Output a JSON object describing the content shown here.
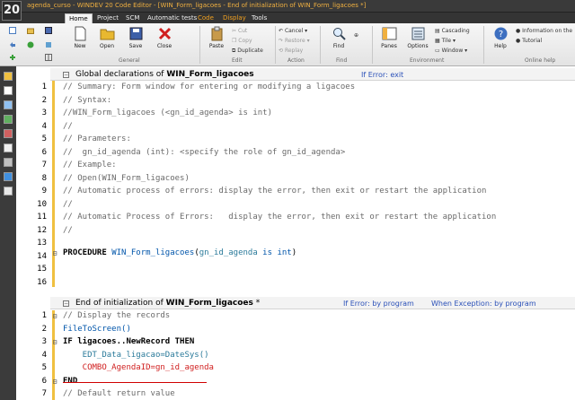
{
  "window": {
    "logo": "20",
    "title": "agenda_curso - WINDEV 20  Code Editor - [WIN_Form_ligacoes - End of initialization of WIN_Form_ligacoes *]"
  },
  "menu": [
    "Home",
    "Project",
    "SCM",
    "Automatic tests",
    "Code",
    "Display",
    "Tools"
  ],
  "ribbon": {
    "general": {
      "new": "New",
      "open": "Open",
      "save": "Save",
      "close": "Close",
      "label": "General"
    },
    "edit": {
      "paste": "Paste",
      "cut": "Cut",
      "copy": "Copy",
      "duplicate": "Duplicate",
      "label": "Edit"
    },
    "action": {
      "cancel": "Cancel",
      "restore": "Restore",
      "replay": "Replay",
      "label": "Action"
    },
    "find": {
      "find": "Find",
      "label": "Find"
    },
    "environment": {
      "panes": "Panes",
      "options": "Options",
      "cascading": "Cascading",
      "tile": "Tile",
      "window": "Window",
      "label": "Environment"
    },
    "online_help": {
      "help": "Help",
      "info": "Information on the",
      "tutorial": "Tutorial",
      "label": "Online help"
    }
  },
  "colors": {
    "title_orange": "#f0b040",
    "error_link_blue": "#2a50b8",
    "code_blue": "#0055aa",
    "code_teal": "#2a7a9a",
    "comment_gray": "#6a6a6a",
    "marker_yellow": "#f0c040",
    "error_red": "#d02020"
  },
  "sections": [
    {
      "title_prefix": "Global declarations of ",
      "title_bold": "WIN_Form_ligacoes",
      "title_suffix": "",
      "error_mode": "If Error: exit",
      "lines": [
        {
          "n": "1",
          "t": "// Summary: Form window for entering or modifying a ligacoes"
        },
        {
          "n": "2",
          "t": "// Syntax:"
        },
        {
          "n": "3",
          "t": "//WIN_Form_ligacoes (<gn_id_agenda> is int)"
        },
        {
          "n": "4",
          "t": "//"
        },
        {
          "n": "5",
          "t": "// Parameters:"
        },
        {
          "n": "6",
          "t": "//  gn_id_agenda (int): <specify the role of gn_id_agenda>"
        },
        {
          "n": "7",
          "t": "// Example:"
        },
        {
          "n": "8",
          "t": "// Open(WIN_Form_ligacoes)"
        },
        {
          "n": "9",
          "t": "// Automatic process of errors: display the error, then exit or restart the application"
        },
        {
          "n": "10",
          "t": "//"
        },
        {
          "n": "11",
          "t": "// Automatic Process of Errors:   display the error, then exit or restart the application"
        },
        {
          "n": "12",
          "t": "//"
        },
        {
          "n": "13",
          "t": ""
        },
        {
          "n": "14",
          "t": ""
        },
        {
          "n": "15",
          "t": ""
        },
        {
          "n": "16",
          "t": ""
        }
      ],
      "procedure": {
        "kw": "PROCEDURE ",
        "name": "WIN_Form_ligacoes",
        "open": "(",
        "param": "gn_id_agenda",
        "is": " is ",
        "type": "int",
        "close": ")"
      }
    },
    {
      "title_prefix": "End of initialization of ",
      "title_bold": "WIN_Form_ligacoes",
      "title_suffix": " *",
      "error_mode": "If Error: by program",
      "exception_mode": "When Exception: by program",
      "lines": [
        {
          "n": "1",
          "t": "// Display the records"
        },
        {
          "n": "2",
          "t": "FileToScreen()"
        },
        {
          "n": "3",
          "t": "IF ligacoes..NewRecord THEN"
        },
        {
          "n": "4",
          "t": "    EDT_Data_ligacao=DateSys()"
        },
        {
          "n": "5",
          "t": "    COMBO_AgendaID=gn_id_agenda"
        },
        {
          "n": "6",
          "t": "END"
        },
        {
          "n": "7",
          "t": "// Default return value"
        }
      ]
    }
  ]
}
